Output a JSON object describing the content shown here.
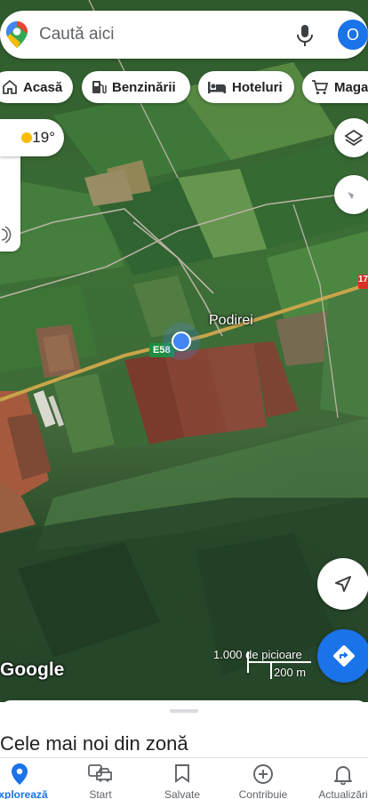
{
  "search": {
    "placeholder": "Caută aici",
    "avatar_initial": "O"
  },
  "chips": [
    {
      "label": "Acasă",
      "icon": "home-icon"
    },
    {
      "label": "Benzinării",
      "icon": "gas-station-icon"
    },
    {
      "label": "Hoteluri",
      "icon": "hotel-bed-icon"
    },
    {
      "label": "Magazine",
      "icon": "shopping-cart-icon"
    }
  ],
  "weather": {
    "temperature": "19°",
    "icon": "sun-icon"
  },
  "map": {
    "place_label": "Podirei",
    "road_label": "E58",
    "road_label_2": "17",
    "attribution": "Google",
    "scale_feet": "1.000 de picioare",
    "scale_meters": "200 m"
  },
  "sheet": {
    "title": "Cele mai noi din zonă"
  },
  "nav": [
    {
      "label": "Explorează",
      "icon": "explore-pin-icon",
      "active": true
    },
    {
      "label": "Start",
      "icon": "car-commute-icon"
    },
    {
      "label": "Salvate",
      "icon": "bookmark-icon"
    },
    {
      "label": "Contribuie",
      "icon": "add-circle-icon"
    },
    {
      "label": "Actualizări",
      "icon": "bell-icon"
    }
  ],
  "colors": {
    "accent": "#1a73e8",
    "nav_fab": "#1a73e8",
    "road_badge": "#1e8e3e"
  }
}
